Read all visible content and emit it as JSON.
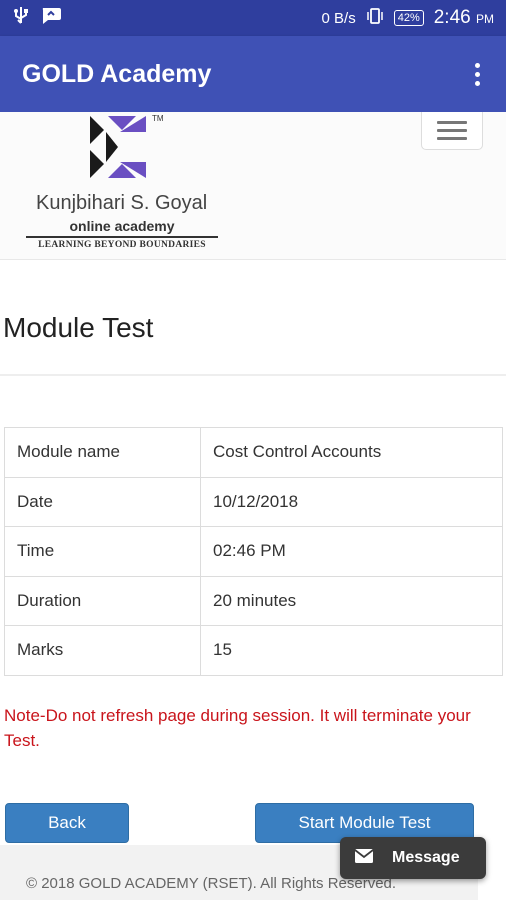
{
  "status_bar": {
    "network_speed": "0 B/s",
    "battery": "42%",
    "time": "2:46",
    "ampm": "PM"
  },
  "app_bar": {
    "title": "GOLD Academy"
  },
  "site_logo": {
    "name": "Kunjbihari S. Goyal",
    "subtitle": "online academy",
    "tagline": "LEARNING BEYOND BOUNDARIES",
    "trademark": "TM"
  },
  "page": {
    "title": "Module Test"
  },
  "details": [
    {
      "label": "Module name",
      "value": "Cost Control Accounts"
    },
    {
      "label": "Date",
      "value": "10/12/2018"
    },
    {
      "label": "Time",
      "value": "02:46 PM"
    },
    {
      "label": "Duration",
      "value": "20 minutes"
    },
    {
      "label": "Marks",
      "value": "15"
    }
  ],
  "note": "Note-Do not refresh page during session. It will terminate your Test.",
  "buttons": {
    "back": "Back",
    "start": "Start Module Test"
  },
  "footer": {
    "copyright": "© 2018 GOLD ACADEMY (RSET). All Rights Reserved."
  },
  "message_chip": {
    "label": "Message"
  },
  "colors": {
    "status_bar": "#2f3e9e",
    "app_bar": "#3f51b5",
    "button": "#3a7fc1",
    "note": "#c9141b"
  }
}
